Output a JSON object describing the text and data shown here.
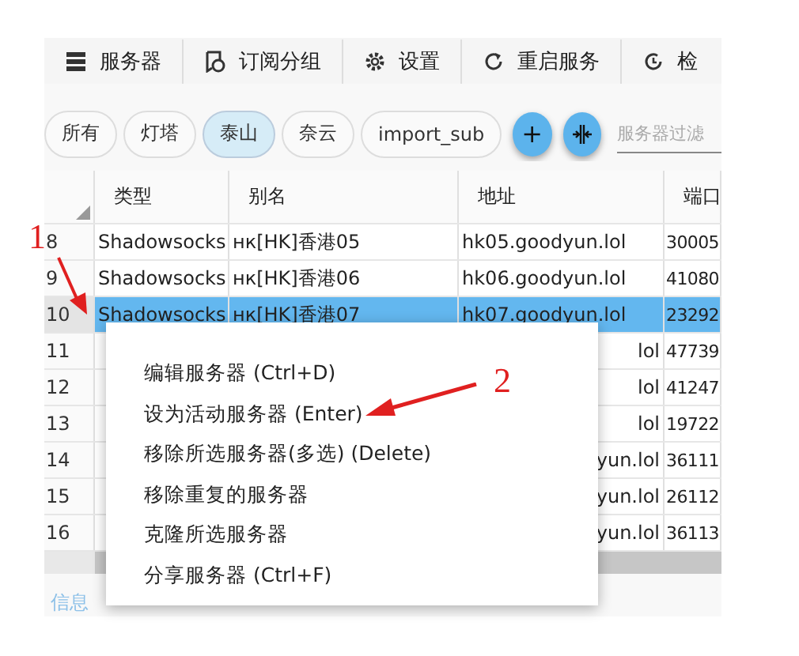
{
  "toolbar": [
    "服务器",
    "订阅分组",
    "设置",
    "重启服务",
    "检"
  ],
  "groups": [
    {
      "label": "所有",
      "selected": false
    },
    {
      "label": "灯塔",
      "selected": false
    },
    {
      "label": "泰山",
      "selected": true
    },
    {
      "label": "奈云",
      "selected": false
    },
    {
      "label": "import_sub",
      "selected": false
    }
  ],
  "group_actions": [
    {
      "label": "+",
      "kind": "add"
    },
    {
      "kind": "split"
    }
  ],
  "filter": {
    "placeholder": "服务器过滤"
  },
  "table": {
    "columns": [
      "类型",
      "别名",
      "地址",
      "端口"
    ],
    "rows": [
      {
        "number": "8",
        "cells": [
          "Shadowsocks",
          "нк[HK]香港05",
          "hk05.goodyun.lol",
          "30005"
        ],
        "selected": false
      },
      {
        "number": "9",
        "cells": [
          "Shadowsocks",
          "нк[HK]香港06",
          "hk06.goodyun.lol",
          "41080"
        ],
        "selected": false
      },
      {
        "number": "10",
        "cells": [
          "Shadowsocks",
          "нк[HK]香港07",
          "hk07.goodyun.lol",
          "23292"
        ],
        "selected": true
      },
      {
        "number": "11",
        "cells": [
          "",
          "",
          "lol",
          "47739"
        ],
        "selected": false
      },
      {
        "number": "12",
        "cells": [
          "",
          "",
          "lol",
          "41247"
        ],
        "selected": false
      },
      {
        "number": "13",
        "cells": [
          "",
          "",
          "lol",
          "19722"
        ],
        "selected": false
      },
      {
        "number": "14",
        "cells": [
          "",
          "",
          "yun.lol",
          "36111"
        ],
        "selected": false
      },
      {
        "number": "15",
        "cells": [
          "",
          "",
          "yun.lol",
          "26112"
        ],
        "selected": false
      },
      {
        "number": "16",
        "cells": [
          "",
          "",
          "yun.lol",
          "36113"
        ],
        "selected": false
      }
    ]
  },
  "context_menu": [
    "编辑服务器 (Ctrl+D)",
    "设为活动服务器 (Enter)",
    "移除所选服务器(多选) (Delete)",
    "移除重复的服务器",
    "克隆所选服务器",
    "分享服务器 (Ctrl+F)"
  ],
  "status_tab": "信息",
  "annotations": [
    "1",
    "2"
  ]
}
